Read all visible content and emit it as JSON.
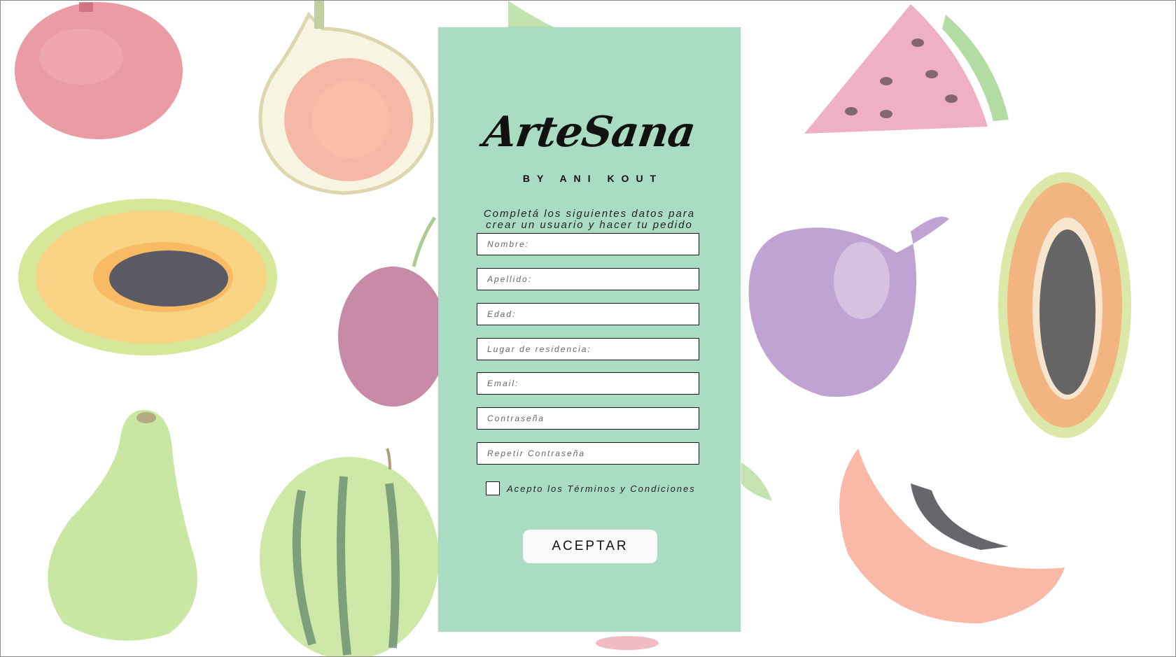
{
  "brand": {
    "logo": "ArteSana",
    "byline": "BY ANI KOUT"
  },
  "form": {
    "intro": "Completá los siguientes datos para crear un usuario y hacer tu pedido",
    "fields": {
      "nombre": "Nombre:",
      "apellido": "Apellido:",
      "edad": "Edad:",
      "residencia": "Lugar de residencia:",
      "email": "Email:",
      "password": "Contraseña",
      "password_repeat": "Repetir Contraseña"
    },
    "terms_label": "Acepto los Términos y Condiciones",
    "terms_checked": false,
    "submit_label": "ACEPTAR"
  },
  "colors": {
    "panel": "#a9dcc2",
    "background": "#ffffff",
    "button": "#fafafa",
    "text": "#111111"
  },
  "background_art": {
    "theme": "watercolor fruit pattern",
    "items": [
      "pomegranate",
      "fig-half",
      "watermelon-slice",
      "papaya-half",
      "plum",
      "fig",
      "papaya-long",
      "pear",
      "watermelon",
      "papaya-slice"
    ]
  }
}
